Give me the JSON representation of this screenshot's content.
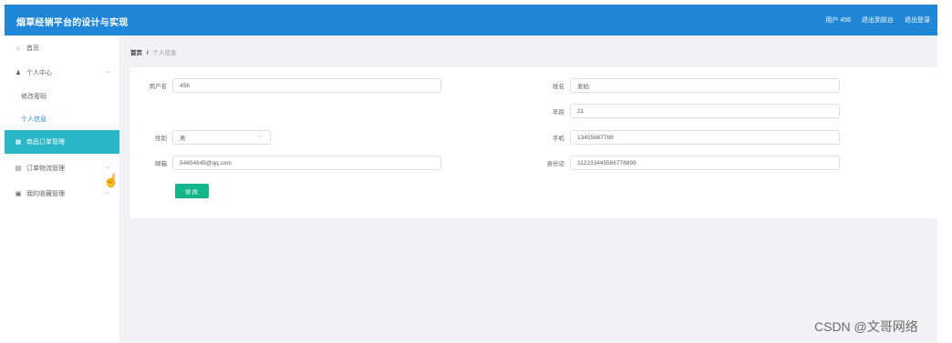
{
  "header": {
    "title": "烟草经销平台的设计与实现",
    "user": "用户 456",
    "back_to_front": "退出到前台",
    "logout": "退出登录"
  },
  "sidebar": {
    "home": {
      "label": "首页",
      "icon": "home-icon"
    },
    "personal_center": {
      "label": "个人中心",
      "icon": "user-icon"
    },
    "change_password": {
      "label": "修改密码"
    },
    "personal_info": {
      "label": "个人信息"
    },
    "product_order": {
      "label": "商品订单管理",
      "icon": "grid-icon"
    },
    "order_logistics": {
      "label": "订单物流管理",
      "icon": "list-icon"
    },
    "my_favorites": {
      "label": "我的收藏管理",
      "icon": "bookmark-icon"
    },
    "highlight_color": "#29b6c7"
  },
  "breadcrumb": {
    "home": "首页",
    "separator": "/",
    "current": "个人信息"
  },
  "form": {
    "username": {
      "label": "用户名",
      "value": "456"
    },
    "name": {
      "label": "姓名",
      "value": "发姑"
    },
    "age": {
      "label": "年龄",
      "value": "21"
    },
    "gender": {
      "label": "性别",
      "value": "男"
    },
    "phone": {
      "label": "手机",
      "value": "13455667788"
    },
    "email": {
      "label": "邮箱",
      "value": "54654645@qq.com"
    },
    "id_card": {
      "label": "身份证",
      "value": "112233445566778899"
    },
    "submit_label": "修改"
  },
  "watermark": "CSDN @文哥网络",
  "colors": {
    "header": "#1f86d8",
    "button": "#13b58a",
    "active": "#1f86d8"
  }
}
